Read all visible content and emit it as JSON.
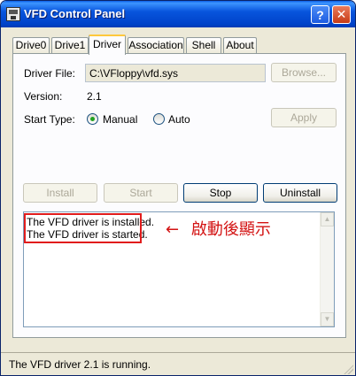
{
  "window": {
    "title": "VFD Control Panel",
    "help_glyph": "?",
    "close_glyph": "✕"
  },
  "tabs": [
    {
      "label": "Drive0"
    },
    {
      "label": "Drive1"
    },
    {
      "label": "Driver",
      "active": true
    },
    {
      "label": "Association"
    },
    {
      "label": "Shell"
    },
    {
      "label": "About"
    }
  ],
  "driver": {
    "file_label": "Driver File:",
    "file_value": "C:\\VFloppy\\vfd.sys",
    "browse_label": "Browse...",
    "version_label": "Version:",
    "version_value": "2.1",
    "start_type_label": "Start Type:",
    "manual_label": "Manual",
    "auto_label": "Auto",
    "start_type_selected": "Manual",
    "apply_label": "Apply"
  },
  "actions": {
    "install_label": "Install",
    "start_label": "Start",
    "stop_label": "Stop",
    "uninstall_label": "Uninstall"
  },
  "log": {
    "lines": [
      "The VFD driver is installed.",
      "The VFD driver is started."
    ]
  },
  "annotation": {
    "arrow": "←",
    "text": "啟動後顯示",
    "color": "#d31313"
  },
  "status": {
    "text": "The VFD driver 2.1 is running."
  },
  "colors": {
    "titlebar": "#0855dd",
    "face": "#ece9d8",
    "highlight_border": "#e11c1c"
  }
}
